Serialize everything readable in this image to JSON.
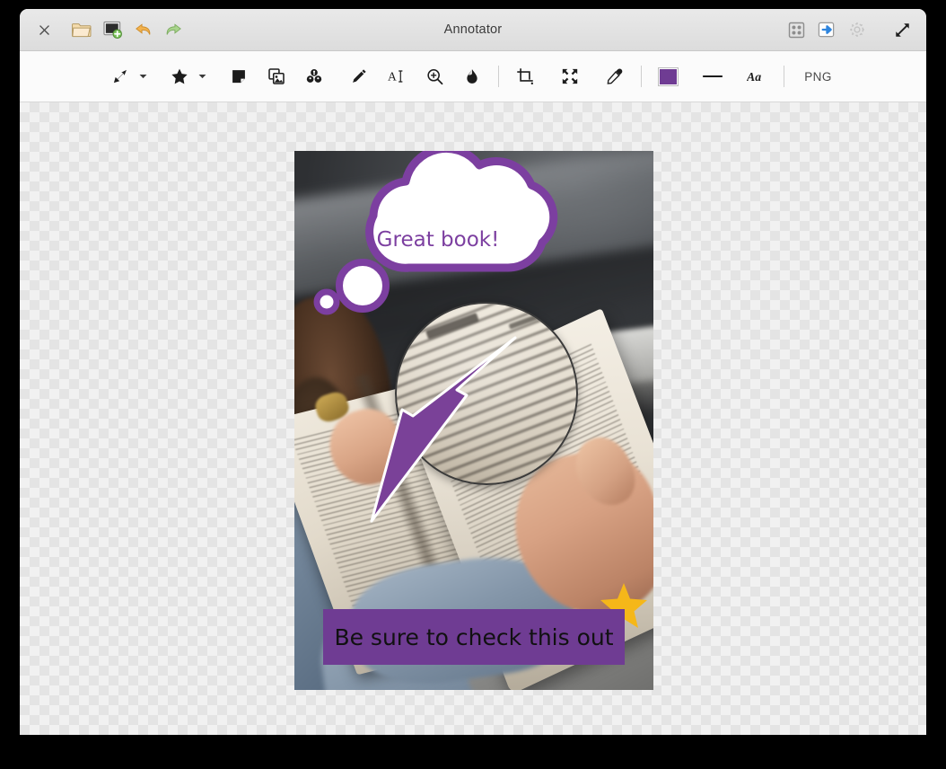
{
  "window": {
    "title": "Annotator"
  },
  "titlebar": {
    "left_buttons": [
      {
        "name": "close-icon",
        "label": "Close"
      },
      {
        "name": "open-folder-icon",
        "label": "Open"
      },
      {
        "name": "new-screenshot-icon",
        "label": "New Screenshot"
      },
      {
        "name": "undo-icon",
        "label": "Undo"
      },
      {
        "name": "redo-icon",
        "label": "Redo"
      }
    ],
    "right_buttons": [
      {
        "name": "thumbnails-icon",
        "label": "Thumbnails"
      },
      {
        "name": "export-icon",
        "label": "Export"
      },
      {
        "name": "settings-gear-icon",
        "label": "Settings"
      },
      {
        "name": "maximize-icon",
        "label": "Maximize"
      }
    ]
  },
  "toolbar": {
    "tools": [
      {
        "name": "arrow-tool",
        "label": "Arrow",
        "has_dropdown": true
      },
      {
        "name": "shape-star-tool",
        "label": "Shape",
        "has_dropdown": true
      },
      {
        "name": "sticker-note-tool",
        "label": "Sticker",
        "has_dropdown": false
      },
      {
        "name": "image-stamp-tool",
        "label": "Image",
        "has_dropdown": false
      },
      {
        "name": "blur-obfuscate-tool",
        "label": "Obfuscate",
        "has_dropdown": false
      },
      {
        "name": "pencil-tool",
        "label": "Pencil",
        "has_dropdown": false
      },
      {
        "name": "text-tool",
        "label": "Text",
        "has_dropdown": false
      },
      {
        "name": "magnifier-tool",
        "label": "Magnifier",
        "has_dropdown": false
      },
      {
        "name": "fill-drop-tool",
        "label": "Fill",
        "has_dropdown": false
      },
      {
        "name": "crop-tool",
        "label": "Crop",
        "has_dropdown": false
      },
      {
        "name": "fit-to-screen-tool",
        "label": "Fit to Screen",
        "has_dropdown": false
      },
      {
        "name": "color-picker-tool",
        "label": "Color Picker",
        "has_dropdown": false
      }
    ],
    "color_swatch": "#6f3c93",
    "line_width_label": "Line width",
    "font_icon_label": "Aa",
    "format_label": "PNG"
  },
  "canvas": {
    "image_alt": "Person reading an open book",
    "annotations": {
      "thought_bubble_text": "Great book!",
      "thought_bubble_color": "#7c3fa0",
      "banner_text": "Be sure to check this out",
      "banner_fill": "#6f3c93",
      "banner_text_color": "#111111",
      "arrow_color": "#7a4198",
      "star_color": "#f5b719",
      "magnifier_border_color": "#3a3a3a"
    }
  }
}
